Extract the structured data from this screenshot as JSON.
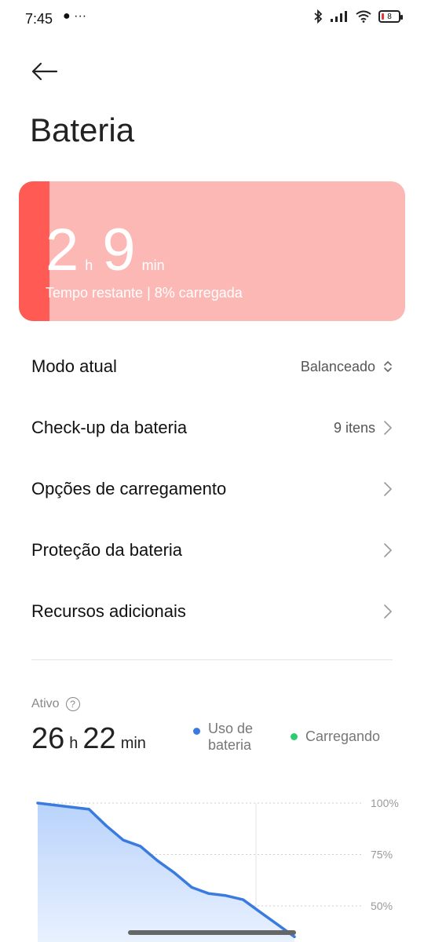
{
  "status_bar": {
    "time": "7:45",
    "left_icons": "● ···",
    "battery_percent": "8"
  },
  "header": {
    "title": "Bateria"
  },
  "battery_card": {
    "hours": "2",
    "hours_unit": "h",
    "minutes": "9",
    "minutes_unit": "min",
    "subtitle": "Tempo restante | 8% carregada",
    "level_fraction": 0.08,
    "color_bg": "#fcb8b4",
    "color_level": "#ff5a54"
  },
  "rows": [
    {
      "label": "Modo atual",
      "value": "Balanceado",
      "icon": "updown-icon"
    },
    {
      "label": "Check-up da bateria",
      "value": "9 itens",
      "icon": "chevron-right-icon"
    },
    {
      "label": "Opções de carregamento",
      "value": "",
      "icon": "chevron-right-icon"
    },
    {
      "label": "Proteção da bateria",
      "value": "",
      "icon": "chevron-right-icon"
    },
    {
      "label": "Recursos adicionais",
      "value": "",
      "icon": "chevron-right-icon"
    }
  ],
  "usage": {
    "active_label": "Ativo",
    "hours": "26",
    "hours_unit": "h",
    "minutes": "22",
    "minutes_unit": "min",
    "legend_usage_line1": "Uso de",
    "legend_usage_line2": "bateria",
    "legend_charging": "Carregando",
    "color_usage": "#3a7be0",
    "color_charging": "#2ecc71"
  },
  "chart_data": {
    "type": "area",
    "ytick_labels": [
      "100%",
      "75%",
      "50%"
    ],
    "ylim": [
      0,
      100
    ],
    "series": [
      {
        "x": [
          0,
          1,
          2,
          3,
          4,
          5,
          6,
          7,
          8,
          9,
          10,
          11,
          12,
          13,
          14,
          15
        ],
        "values": [
          100,
          99,
          98,
          97,
          89,
          82,
          79,
          72,
          66,
          59,
          56,
          55,
          53,
          47,
          41,
          35
        ]
      }
    ]
  }
}
